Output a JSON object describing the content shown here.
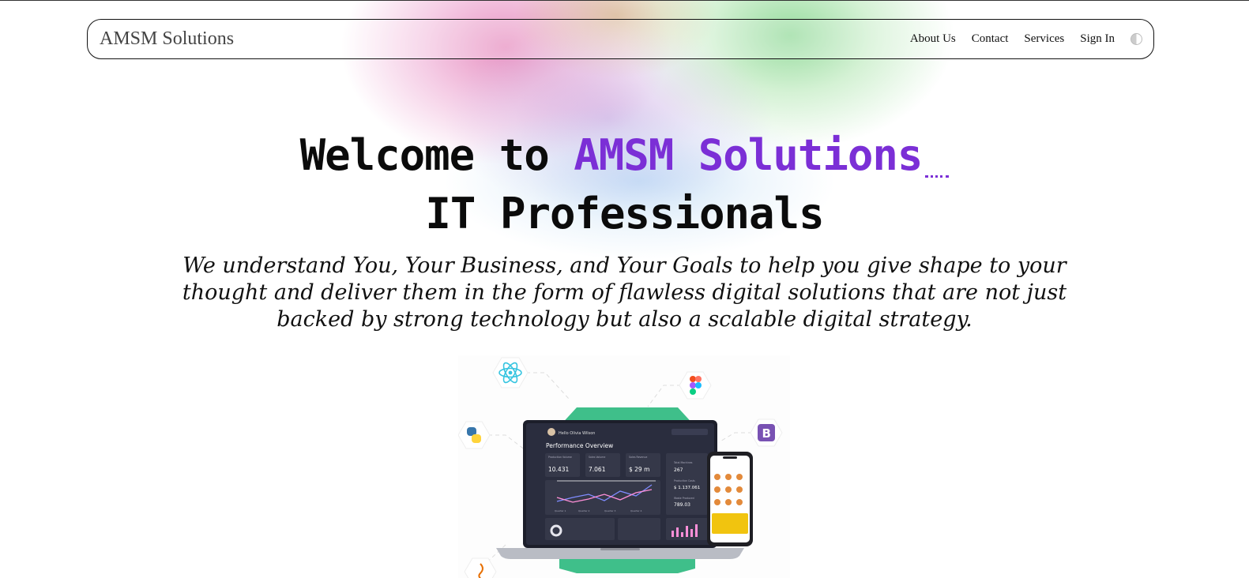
{
  "navbar": {
    "brand": "AMSM Solutions",
    "links": [
      "About Us",
      "Contact",
      "Services",
      "Sign In"
    ],
    "theme_toggle_icon": "half-circle-theme-icon"
  },
  "hero": {
    "line1_prefix": "Welcome to",
    "line1_accent": "AMSM Solutions",
    "line2": "IT Professionals",
    "accent_color": "#7b2fd6"
  },
  "tagline": "We understand You, Your Business, and Your Goals to help you give shape to your thought and deliver them in the form of flawless digital solutions that are not just backed by strong technology but also a scalable digital strategy.",
  "illustration": {
    "dashboard": {
      "user_name": "Hello Olivia Wilson",
      "title": "Performance Overview",
      "kpis": [
        {
          "label": "Production Volume",
          "value": "10.431"
        },
        {
          "label": "Sales Volume",
          "value": "7.061"
        },
        {
          "label": "Sales Revenue",
          "value": "$ 29 m"
        }
      ],
      "side_stats": [
        {
          "label": "Total Machines",
          "value": "267"
        },
        {
          "label": "Production Costs",
          "value": "$ 1.137.061"
        },
        {
          "label": "Waste Produced",
          "value": "789.03"
        }
      ],
      "chart_axis": [
        "Quarter 1",
        "Quarter 2",
        "Quarter 3",
        "Quarter 4"
      ]
    },
    "tech_icons": [
      "react-icon",
      "figma-icon",
      "python-icon",
      "bootstrap-icon",
      "java-icon"
    ],
    "colors": {
      "accent_green": "#3fbf8a",
      "dashboard_bg": "#2a2d3e"
    }
  }
}
